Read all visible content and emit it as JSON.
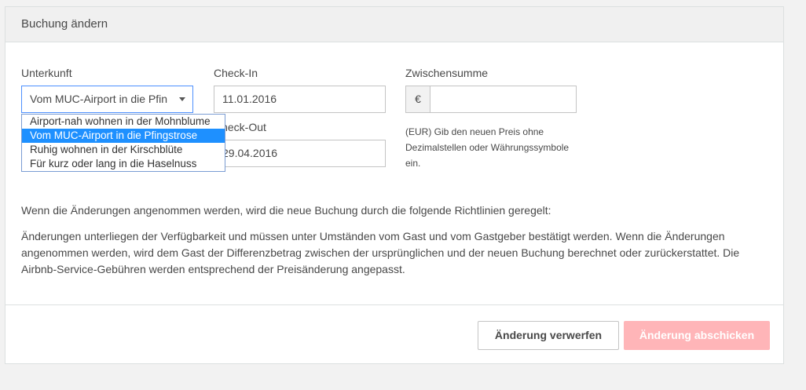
{
  "panel": {
    "title": "Buchung ändern"
  },
  "form": {
    "accommodation": {
      "label": "Unterkunft",
      "selected": "Vom MUC-Airport in die Pfin",
      "options": [
        "Airport-nah wohnen in der Mohnblume",
        "Vom MUC-Airport in die Pfingstrose",
        "Ruhig wohnen in der Kirschblüte",
        "Für kurz oder lang in die Haselnuss"
      ]
    },
    "checkin": {
      "label": "Check-In",
      "value": "11.01.2016"
    },
    "checkout": {
      "label": "Check-Out",
      "value": "29.04.2016"
    },
    "subtotal": {
      "label": "Zwischensumme",
      "currency_symbol": "€",
      "value": "",
      "hint": "(EUR) Gib den neuen Preis ohne Dezimalstellen oder Währungssymbole ein."
    }
  },
  "policy": {
    "intro": "Wenn die Änderungen angenommen werden, wird die neue Buchung durch die folgende Richtlinien geregelt:",
    "text": "Änderungen unterliegen der Verfügbarkeit und müssen unter Umständen vom Gast und vom Gastgeber bestätigt werden. Wenn die Änderungen angenommen werden, wird dem Gast der Differenzbetrag zwischen der ursprünglichen und der neuen Buchung berechnet oder zurückerstattet. Die Airbnb-Service-Gebühren werden entsprechend der Preisänderung angepasst."
  },
  "actions": {
    "discard_label": "Änderung verwerfen",
    "submit_label": "Änderung abschicken"
  },
  "colors": {
    "select_focus": "#4d90fe",
    "option_highlight": "#1e90ff",
    "submit_disabled": "#ffb5b8"
  }
}
